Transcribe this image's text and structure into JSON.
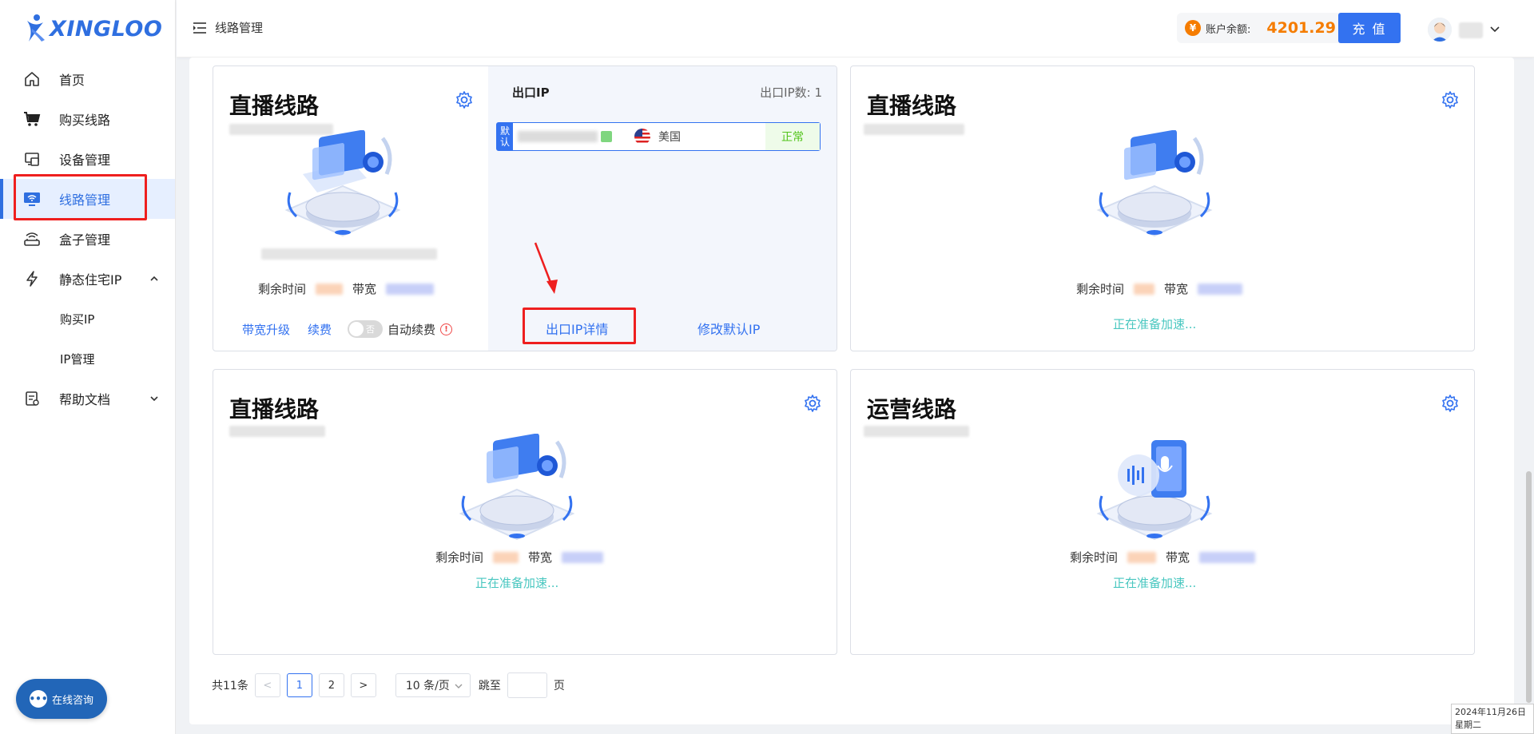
{
  "brand": {
    "name": "XINGLOO"
  },
  "sidebar": {
    "items": [
      {
        "label": "首页",
        "icon": "home-icon"
      },
      {
        "label": "购买线路",
        "icon": "cart-icon"
      },
      {
        "label": "设备管理",
        "icon": "device-icon"
      },
      {
        "label": "线路管理",
        "icon": "monitor-wifi-icon",
        "active": true
      },
      {
        "label": "盒子管理",
        "icon": "router-icon"
      },
      {
        "label": "静态住宅IP",
        "icon": "lightning-icon",
        "expanded": true
      },
      {
        "label": "帮助文档",
        "icon": "document-icon",
        "expanded": false
      }
    ],
    "submenu": [
      "购买IP",
      "IP管理"
    ]
  },
  "chat": {
    "label": "在线咨询"
  },
  "header": {
    "breadcrumb": "线路管理",
    "balance_label": "账户余额:",
    "balance_value": "4201.29",
    "coin_symbol": "¥",
    "recharge_label": "充 值"
  },
  "cards": [
    {
      "title": "直播线路",
      "remaining_label": "剩余时间",
      "bandwidth_label": "带宽",
      "upgrade_label": "带宽升级",
      "renew_label": "续费",
      "toggle_label": "否",
      "auto_renew_label": "自动续费",
      "exit_ip": {
        "title": "出口IP",
        "count_label": "出口IP数: 1",
        "default_tag": "默认",
        "country": "美国",
        "status": "正常",
        "detail_label": "出口IP详情",
        "modify_label": "修改默认IP"
      }
    },
    {
      "title": "直播线路",
      "remaining_label": "剩余时间",
      "bandwidth_label": "带宽",
      "status": "正在准备加速",
      "status_tail": "..."
    },
    {
      "title": "直播线路",
      "remaining_label": "剩余时间",
      "bandwidth_label": "带宽",
      "status": "正在准备加速",
      "status_tail": "..."
    },
    {
      "title": "运营线路",
      "remaining_label": "剩余时间",
      "bandwidth_label": "带宽",
      "status": "正在准备加速",
      "status_tail": "..."
    }
  ],
  "pagination": {
    "total_label": "共11条",
    "prev": "<",
    "next": ">",
    "pages": [
      "1",
      "2"
    ],
    "current": "1",
    "page_size": "10 条/页",
    "jump_label": "跳至",
    "page_unit": "页"
  },
  "clock": {
    "date": "2024年11月26日",
    "weekday": "星期二"
  },
  "colors": {
    "accent": "#3372f0",
    "balance": "#f57c00",
    "highlight": "#ee1f1f",
    "status_ok": "#52c41a",
    "preparing": "#49c7c0"
  }
}
